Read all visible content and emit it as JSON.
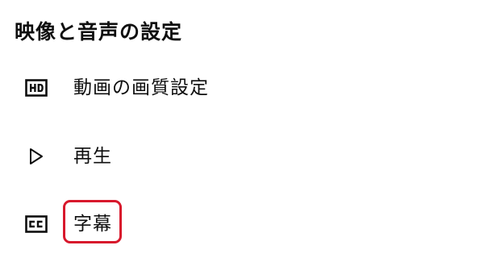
{
  "section": {
    "title": "映像と音声の設定"
  },
  "items": [
    {
      "id": "quality",
      "icon": "hd-icon",
      "label": "動画の画質設定"
    },
    {
      "id": "playback",
      "icon": "play-icon",
      "label": "再生"
    },
    {
      "id": "subtitles",
      "icon": "closed-caption-icon",
      "label": "字幕"
    }
  ],
  "highlight": {
    "target": "subtitles",
    "color": "#d8182c"
  }
}
